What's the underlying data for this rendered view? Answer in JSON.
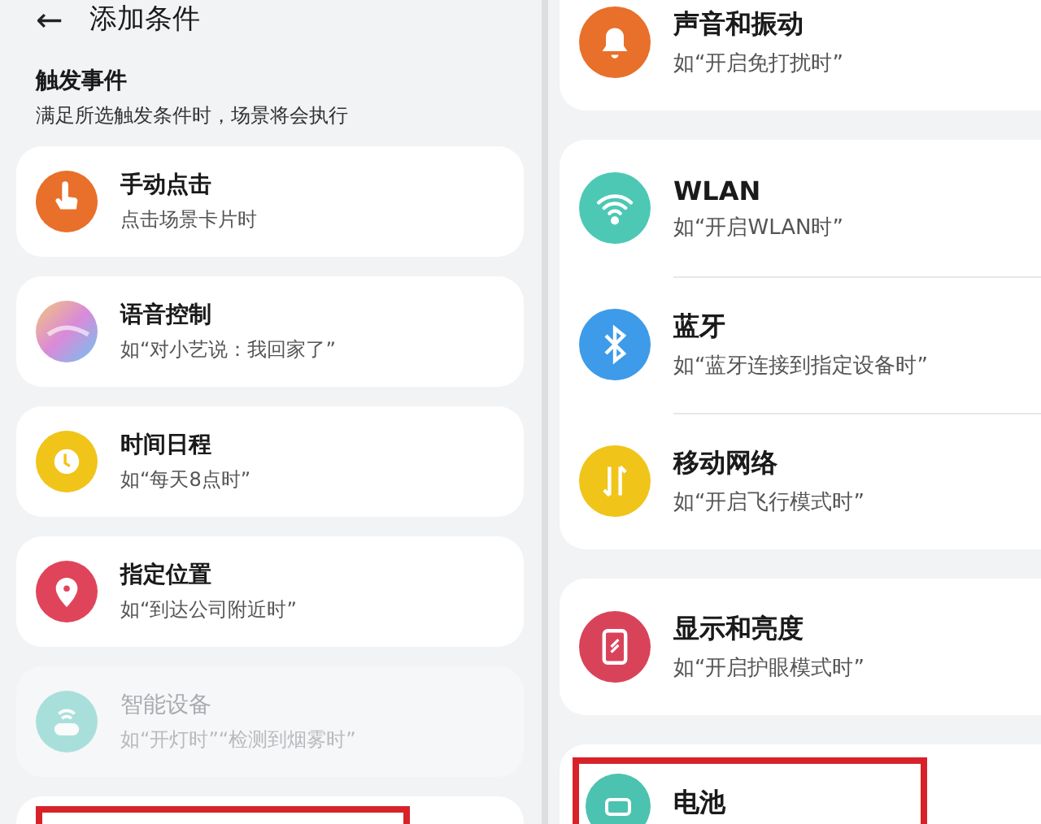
{
  "left": {
    "header": {
      "back": "←",
      "title": "添加条件"
    },
    "section": {
      "title": "触发事件",
      "subtitle": "满足所选触发条件时，场景将会执行"
    },
    "items": [
      {
        "kind": "tap",
        "title": "手动点击",
        "subtitle": "点击场景卡片时",
        "disabled": false,
        "highlighted": false
      },
      {
        "kind": "voice",
        "title": "语音控制",
        "subtitle": "如“对小艺说：我回家了”",
        "disabled": false,
        "highlighted": false
      },
      {
        "kind": "clock",
        "title": "时间日程",
        "subtitle": "如“每天8点时”",
        "disabled": false,
        "highlighted": false
      },
      {
        "kind": "location",
        "title": "指定位置",
        "subtitle": "如“到达公司附近时”",
        "disabled": false,
        "highlighted": false
      },
      {
        "kind": "device",
        "title": "智能设备",
        "subtitle": "如“开灯时”“检测到烟雾时”",
        "disabled": true,
        "highlighted": false
      },
      {
        "kind": "blank",
        "disabled": false,
        "highlighted": true
      }
    ]
  },
  "right": {
    "cards": [
      {
        "rows": [
          {
            "kind": "bell",
            "title": "声音和振动",
            "subtitle": "如“开启免打扰时”",
            "highlighted": false
          }
        ]
      },
      {
        "rows": [
          {
            "kind": "wifi",
            "title": "WLAN",
            "subtitle": "如“开启WLAN时”",
            "highlighted": false
          },
          {
            "kind": "bluetooth",
            "title": "蓝牙",
            "subtitle": "如“蓝牙连接到指定设备时”",
            "highlighted": false
          },
          {
            "kind": "mobile",
            "title": "移动网络",
            "subtitle": "如“开启飞行模式时”",
            "highlighted": false
          }
        ]
      },
      {
        "rows": [
          {
            "kind": "display",
            "title": "显示和亮度",
            "subtitle": "如“开启护眼模式时”",
            "highlighted": false
          }
        ]
      },
      {
        "rows": [
          {
            "kind": "battery",
            "title": "电池",
            "highlighted": true
          }
        ]
      }
    ]
  }
}
